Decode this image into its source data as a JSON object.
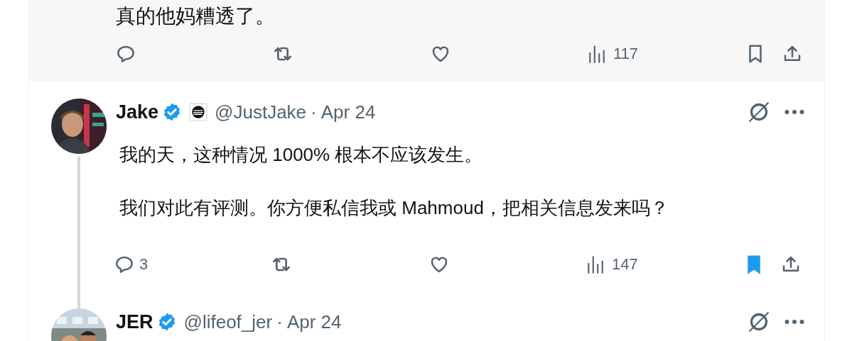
{
  "previous_tweet": {
    "text": "真的他妈糟透了。",
    "views": "117",
    "bookmarked": false
  },
  "tweets": [
    {
      "name": "Jake",
      "verified": true,
      "affiliate_badge": true,
      "handle": "@JustJake",
      "separator": "·",
      "date": "Apr 24",
      "paragraphs": [
        "我的天，这种情况 1000% 根本不应该发生。",
        "我们对此有评测。你方便私信我或 Mahmoud，把相关信息发来吗？"
      ],
      "replies": "3",
      "views": "147",
      "bookmarked": true,
      "thread_line": true
    },
    {
      "name": "JER",
      "verified": true,
      "affiliate_badge": false,
      "handle": "@lifeof_jer",
      "separator": "·",
      "date": "Apr 24",
      "thread_line": false
    }
  ]
}
